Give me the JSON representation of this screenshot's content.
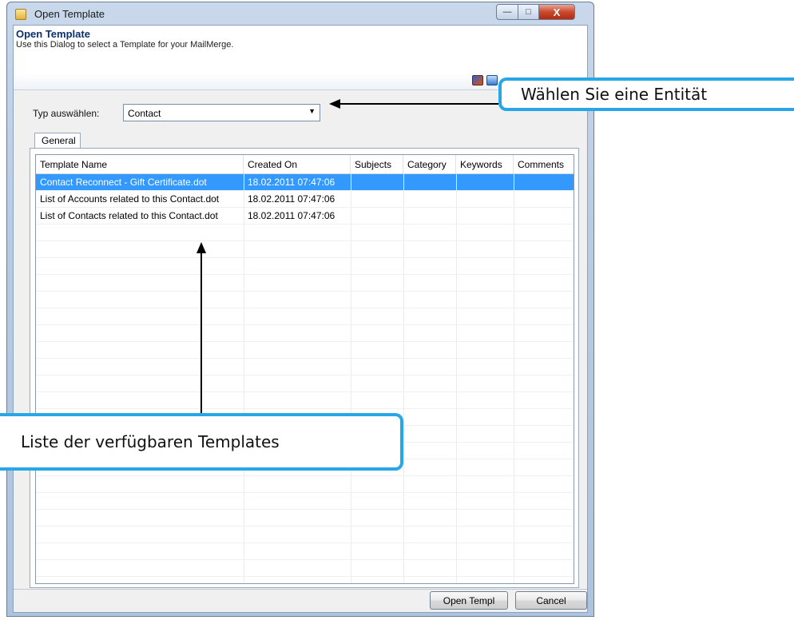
{
  "window": {
    "title": "Open Template",
    "caption_buttons": {
      "minimize": "—",
      "maximize": "□",
      "close": "X"
    }
  },
  "header": {
    "title": "Open Template",
    "description": "Use this Dialog to select a Template for your MailMerge.",
    "toolbar_icons": [
      "open-file-icon",
      "folder-icon"
    ]
  },
  "type_selector": {
    "label": "Typ auswählen:",
    "value": "Contact",
    "arrow": "▼"
  },
  "tabs": [
    {
      "label": "General"
    }
  ],
  "template_list": {
    "columns": [
      "Template Name",
      "Created On",
      "Subjects",
      "Category",
      "Keywords",
      "Comments"
    ],
    "rows": [
      [
        "Contact Reconnect - Gift Certificate.dot",
        "18.02.2011 07:47:06",
        "",
        "",
        "",
        ""
      ],
      [
        "List of Accounts related to this Contact.dot",
        "18.02.2011 07:47:06",
        "",
        "",
        "",
        ""
      ],
      [
        "List of Contacts related to this Contact.dot",
        "18.02.2011 07:47:06",
        "",
        "",
        "",
        ""
      ]
    ],
    "selected_row": 0
  },
  "buttons": {
    "open": "Open Templ",
    "cancel": "Cancel"
  },
  "annotations": {
    "entity": "Wählen Sie eine Entität",
    "list": "Liste der verfügbaren Templates",
    "color": "#27a7e8"
  }
}
